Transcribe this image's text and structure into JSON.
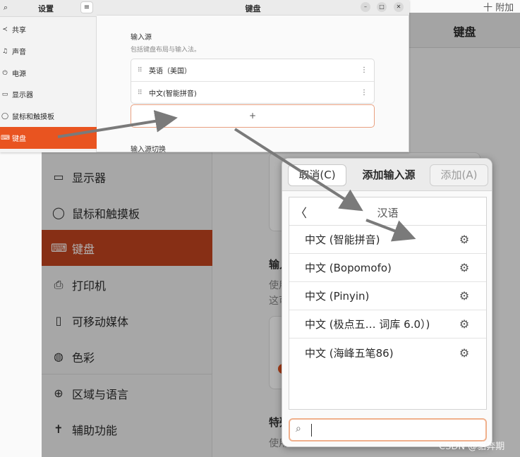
{
  "background_window": {
    "title": "键盘",
    "top_fragment": "十 附加",
    "sidebar": [
      {
        "label": "显示器",
        "icon": "display-icon"
      },
      {
        "label": "鼠标和触摸板",
        "icon": "mouse-icon"
      },
      {
        "label": "键盘",
        "icon": "keyboard-icon",
        "active": true
      },
      {
        "label": "打印机",
        "icon": "printer-icon"
      },
      {
        "label": "可移动媒体",
        "icon": "removable-media-icon"
      },
      {
        "label": "色彩",
        "icon": "color-icon"
      },
      {
        "label": "区域与语言",
        "icon": "globe-icon"
      },
      {
        "label": "辅助功能",
        "icon": "accessibility-icon"
      }
    ],
    "main_fragments": {
      "input_heading": "输入",
      "input_desc1": "使用",
      "input_desc2": "这可",
      "special_heading": "特殊",
      "special_desc": "使用"
    }
  },
  "small_window": {
    "sidebar_title": "设置",
    "title": "键盘",
    "sidebar": [
      {
        "label": "共享",
        "icon": "share-icon"
      },
      {
        "label": "声音",
        "icon": "music-icon"
      },
      {
        "label": "电源",
        "icon": "power-icon"
      },
      {
        "label": "显示器",
        "icon": "display-icon"
      },
      {
        "label": "鼠标和触摸板",
        "icon": "mouse-icon"
      },
      {
        "label": "键盘",
        "icon": "keyboard-icon",
        "active": true
      }
    ],
    "section_title": "输入源",
    "section_desc": "包括键盘布局与输入法。",
    "input_sources": [
      "英语（美国）",
      "中文(智能拼音)"
    ],
    "add_symbol": "+",
    "switch_section": "输入源切换"
  },
  "dialog": {
    "cancel_label": "取消(C)",
    "title": "添加输入源",
    "add_label": "添加(A)",
    "back_symbol": "〈",
    "language": "汉语",
    "items": [
      "中文 (智能拼音)",
      "中文 (Bopomofo)",
      "中文 (Pinyin)",
      "中文 (极点五…   词库 6.0）)",
      "中文 (海峰五笔86)"
    ],
    "search_value": ""
  },
  "watermark": "CSDN @骆奔期",
  "colors": {
    "accent": "#e95420",
    "accent_dim": "#c2441f",
    "arrow": "#7a7a7a"
  }
}
